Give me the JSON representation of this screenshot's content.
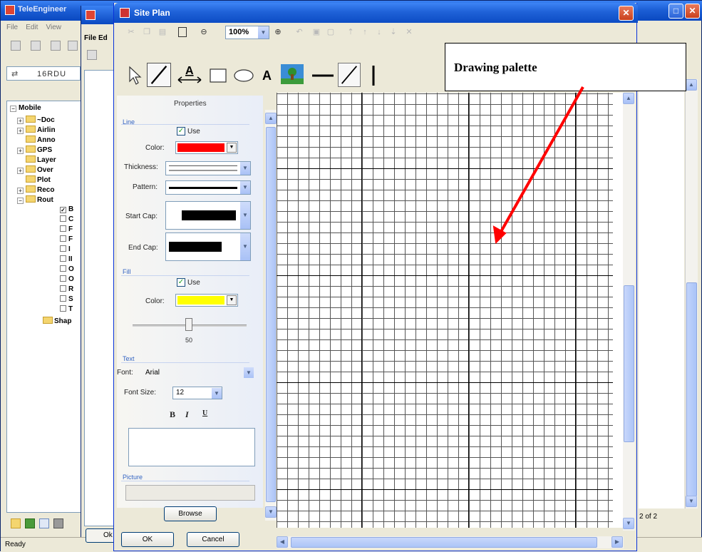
{
  "background_app": {
    "title": "TeleEngineer",
    "menu": [
      "File",
      "Edit",
      "View"
    ],
    "route_value": "16RDU",
    "tree": {
      "root": "Mobile",
      "items": [
        "~Doc",
        "Airlin",
        "Anno",
        "GPS",
        "Layer",
        "Over",
        "Plot",
        "Reco",
        "Rout",
        "Shap"
      ],
      "sub_items": [
        "B",
        "C",
        "F",
        "F",
        "I",
        "II",
        "O",
        "O",
        "R",
        "S",
        "T"
      ]
    },
    "page_counter": "2 of 2",
    "status": "Ready"
  },
  "middle_window": {
    "menu": "File Ed",
    "ok_label": "Ok"
  },
  "site_plan": {
    "title": "Site Plan",
    "zoom": "100%",
    "properties": {
      "title": "Properties",
      "line_section": "Line",
      "line_use_label": "Use",
      "line_use_checked": true,
      "color_label": "Color:",
      "line_color": "#ff0000",
      "thickness_label": "Thickness:",
      "pattern_label": "Pattern:",
      "start_cap_label": "Start Cap:",
      "end_cap_label": "End Cap:",
      "fill_section": "Fill",
      "fill_use_label": "Use",
      "fill_use_checked": true,
      "fill_color_label": "Color:",
      "fill_color": "#ffff00",
      "opacity_value": "50",
      "text_section": "Text",
      "font_label": "Font:",
      "font_value": "Arial",
      "font_size_label": "Font Size:",
      "font_size_value": "12",
      "bold_label": "B",
      "italic_label": "I",
      "underline_label": "U",
      "picture_section": "Picture",
      "browse_label": "Browse"
    },
    "ok_label": "OK",
    "cancel_label": "Cancel"
  },
  "annotation": {
    "label": "Drawing palette",
    "arrow_color": "#ff0000"
  },
  "icons": [
    "pointer-icon",
    "line-tool-icon",
    "dimension-tool-icon",
    "rectangle-tool-icon",
    "ellipse-tool-icon",
    "text-tool-icon",
    "picture-tool-icon",
    "horizontal-line-icon",
    "diagonal-line-icon",
    "vertical-line-icon"
  ]
}
